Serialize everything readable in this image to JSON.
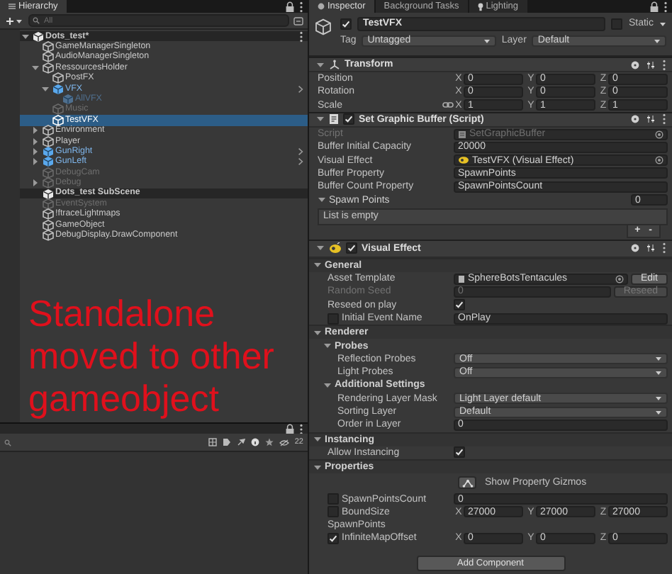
{
  "hierarchy": {
    "tab": "Hierarchy",
    "search_placeholder": "All",
    "items": [
      {
        "kind": "scene",
        "name": "Dots_test*",
        "expanded": true,
        "selected": false,
        "disabled": false,
        "prefab": false,
        "children": [
          {
            "kind": "object",
            "name": "GameManagerSingleton",
            "selected": false,
            "disabled": false,
            "prefab": false
          },
          {
            "kind": "object",
            "name": "AudioManagerSingleton",
            "selected": false,
            "disabled": false,
            "prefab": false
          },
          {
            "kind": "object",
            "name": "RessourcesHolder",
            "expanded": true,
            "selected": false,
            "disabled": false,
            "prefab": false,
            "children": [
              {
                "kind": "object",
                "name": "PostFX",
                "selected": false,
                "disabled": false,
                "prefab": false
              },
              {
                "kind": "object",
                "name": "VFX",
                "expanded": true,
                "selected": false,
                "disabled": false,
                "prefab": true,
                "children": [
                  {
                    "kind": "object",
                    "name": "AllVFX",
                    "selected": false,
                    "disabled": true,
                    "prefab": true
                  }
                ]
              },
              {
                "kind": "object",
                "name": "Music",
                "selected": false,
                "disabled": true,
                "prefab": false
              },
              {
                "kind": "object",
                "name": "TestVFX",
                "selected": true,
                "disabled": false,
                "prefab": false
              }
            ]
          },
          {
            "kind": "object",
            "name": "Environment",
            "expanded": false,
            "selected": false,
            "disabled": false,
            "prefab": false
          },
          {
            "kind": "object",
            "name": "Player",
            "expanded": false,
            "selected": false,
            "disabled": false,
            "prefab": false
          },
          {
            "kind": "object",
            "name": "GunRight",
            "expanded": false,
            "selected": false,
            "disabled": false,
            "prefab": true
          },
          {
            "kind": "object",
            "name": "GunLeft",
            "expanded": false,
            "selected": false,
            "disabled": false,
            "prefab": true
          },
          {
            "kind": "object",
            "name": "DebugCam",
            "selected": false,
            "disabled": true,
            "prefab": false
          },
          {
            "kind": "object",
            "name": "Debug",
            "expanded": false,
            "selected": false,
            "disabled": true,
            "prefab": false
          },
          {
            "kind": "scene",
            "name": "Dots_test SubScene",
            "selected": false,
            "disabled": false,
            "prefab": false
          },
          {
            "kind": "object",
            "name": "EventSystem",
            "selected": false,
            "disabled": true,
            "prefab": false
          },
          {
            "kind": "object",
            "name": "!ftraceLightmaps",
            "selected": false,
            "disabled": false,
            "prefab": false
          },
          {
            "kind": "object",
            "name": "GameObject",
            "selected": false,
            "disabled": false,
            "prefab": false
          },
          {
            "kind": "object",
            "name": "DebugDisplay.DrawComponent",
            "selected": false,
            "disabled": false,
            "prefab": false
          }
        ]
      }
    ]
  },
  "annotation": "Standalone moved to other gameobject",
  "project": {
    "hidden_count": "22"
  },
  "inspector": {
    "tabs": [
      {
        "label": "Inspector",
        "selected": true
      },
      {
        "label": "Background Tasks",
        "selected": false
      },
      {
        "label": "Lighting",
        "selected": false
      }
    ],
    "object": {
      "active": true,
      "name": "TestVFX",
      "static": false,
      "static_label": "Static",
      "tag_label": "Tag",
      "tag": "Untagged",
      "layer_label": "Layer",
      "layer": "Default"
    },
    "components": [
      {
        "kind": "transform",
        "title": "Transform",
        "expanded": true,
        "rows": [
          {
            "kind": "vector3",
            "label": "Position",
            "constrained": false,
            "axes": [
              {
                "axis": "X",
                "value": "0"
              },
              {
                "axis": "Y",
                "value": "0"
              },
              {
                "axis": "Z",
                "value": "0"
              }
            ]
          },
          {
            "kind": "vector3",
            "label": "Rotation",
            "constrained": false,
            "axes": [
              {
                "axis": "X",
                "value": "0"
              },
              {
                "axis": "Y",
                "value": "0"
              },
              {
                "axis": "Z",
                "value": "0"
              }
            ]
          },
          {
            "kind": "vector3",
            "label": "Scale",
            "constrained": true,
            "axes": [
              {
                "axis": "X",
                "value": "1"
              },
              {
                "axis": "Y",
                "value": "1"
              },
              {
                "axis": "Z",
                "value": "1"
              }
            ]
          }
        ]
      },
      {
        "kind": "script",
        "title": "Set Graphic Buffer (Script)",
        "enabled": true,
        "expanded": true,
        "rows": [
          {
            "kind": "script_object",
            "label": "Script",
            "value": "SetGraphicBuffer",
            "disabled": true
          },
          {
            "kind": "field",
            "label": "Buffer Initial Capacity",
            "value": "20000",
            "disabled": false
          },
          {
            "kind": "vfx_object",
            "label": "Visual Effect",
            "value": "TestVFX (Visual Effect)",
            "disabled": false
          },
          {
            "kind": "field",
            "label": "Buffer Property",
            "value": "SpawnPoints",
            "disabled": false
          },
          {
            "kind": "field",
            "label": "Buffer Count Property",
            "value": "SpawnPointsCount",
            "disabled": false
          },
          {
            "kind": "list",
            "label": "Spawn Points",
            "expanded": true,
            "count": "0",
            "empty_text": "List is empty",
            "add": "+",
            "remove": "-"
          }
        ]
      },
      {
        "kind": "vfx",
        "title": "Visual Effect",
        "enabled": true,
        "expanded": true,
        "rows": [
          {
            "kind": "section",
            "label": "General",
            "expanded": true,
            "children": [
              {
                "kind": "asset_object",
                "label": "Asset Template",
                "value": "SphereBotsTentacules",
                "disabled": false,
                "button": "Edit"
              },
              {
                "kind": "field",
                "label": "Random Seed",
                "value": "0",
                "disabled": true,
                "button": "Reseed"
              },
              {
                "kind": "toggle",
                "label": "Reseed on play",
                "checked": true
              },
              {
                "kind": "field",
                "label": "Initial Event Name",
                "value": "OnPlay",
                "disabled": false,
                "override": false
              }
            ]
          },
          {
            "kind": "section",
            "label": "Renderer",
            "expanded": true,
            "children": [
              {
                "kind": "section",
                "label": "Probes",
                "expanded": true,
                "children": [
                  {
                    "kind": "dropdown",
                    "label": "Reflection Probes",
                    "value": "Off"
                  },
                  {
                    "kind": "dropdown",
                    "label": "Light Probes",
                    "value": "Off"
                  }
                ]
              },
              {
                "kind": "section",
                "label": "Additional Settings",
                "expanded": true,
                "children": [
                  {
                    "kind": "dropdown",
                    "label": "Rendering Layer Mask",
                    "value": "Light Layer default"
                  },
                  {
                    "kind": "dropdown",
                    "label": "Sorting Layer",
                    "value": "Default"
                  },
                  {
                    "kind": "field",
                    "label": "Order in Layer",
                    "value": "0",
                    "disabled": false
                  }
                ]
              }
            ]
          },
          {
            "kind": "section",
            "label": "Instancing",
            "expanded": true,
            "children": [
              {
                "kind": "toggle",
                "label": "Allow Instancing",
                "checked": true
              }
            ]
          },
          {
            "kind": "section",
            "label": "Properties",
            "expanded": true,
            "children": [
              {
                "kind": "gizmo_button",
                "label": "Show Property Gizmos"
              },
              {
                "kind": "field",
                "label": "SpawnPointsCount",
                "value": "0",
                "disabled": false,
                "override": false
              },
              {
                "kind": "vector3",
                "label": "BoundSize",
                "constrained": false,
                "override": false,
                "axes": [
                  {
                    "axis": "X",
                    "value": "27000"
                  },
                  {
                    "axis": "Y",
                    "value": "27000"
                  },
                  {
                    "axis": "Z",
                    "value": "27000"
                  }
                ]
              },
              {
                "kind": "label",
                "label": "SpawnPoints"
              },
              {
                "kind": "vector3",
                "label": "InfiniteMapOffset",
                "constrained": false,
                "override": true,
                "axes": [
                  {
                    "axis": "X",
                    "value": "0"
                  },
                  {
                    "axis": "Y",
                    "value": "0"
                  },
                  {
                    "axis": "Z",
                    "value": "0"
                  }
                ]
              }
            ]
          }
        ]
      }
    ],
    "add_component": "Add Component"
  }
}
